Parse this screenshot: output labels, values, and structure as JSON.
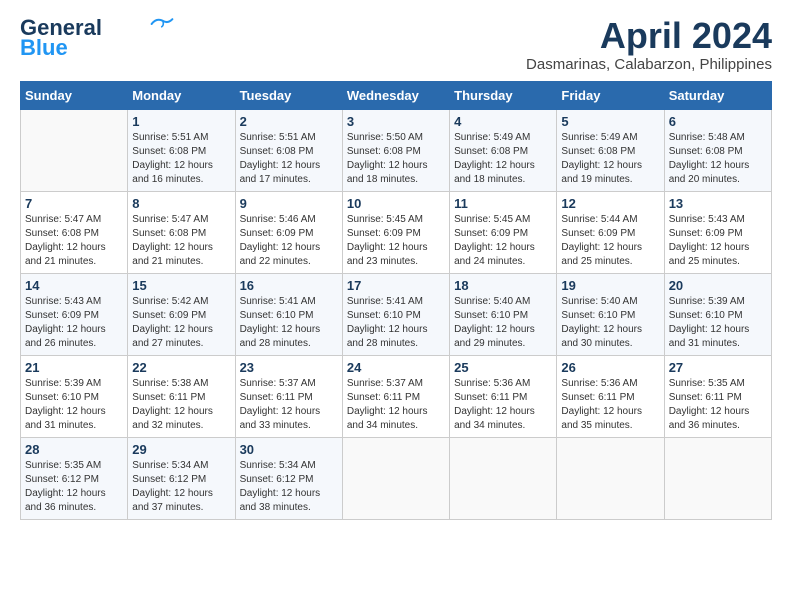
{
  "header": {
    "logo_line1": "General",
    "logo_line2": "Blue",
    "month_title": "April 2024",
    "location": "Dasmarinas, Calabarzon, Philippines"
  },
  "weekdays": [
    "Sunday",
    "Monday",
    "Tuesday",
    "Wednesday",
    "Thursday",
    "Friday",
    "Saturday"
  ],
  "weeks": [
    [
      {
        "day": "",
        "info": ""
      },
      {
        "day": "1",
        "info": "Sunrise: 5:51 AM\nSunset: 6:08 PM\nDaylight: 12 hours\nand 16 minutes."
      },
      {
        "day": "2",
        "info": "Sunrise: 5:51 AM\nSunset: 6:08 PM\nDaylight: 12 hours\nand 17 minutes."
      },
      {
        "day": "3",
        "info": "Sunrise: 5:50 AM\nSunset: 6:08 PM\nDaylight: 12 hours\nand 18 minutes."
      },
      {
        "day": "4",
        "info": "Sunrise: 5:49 AM\nSunset: 6:08 PM\nDaylight: 12 hours\nand 18 minutes."
      },
      {
        "day": "5",
        "info": "Sunrise: 5:49 AM\nSunset: 6:08 PM\nDaylight: 12 hours\nand 19 minutes."
      },
      {
        "day": "6",
        "info": "Sunrise: 5:48 AM\nSunset: 6:08 PM\nDaylight: 12 hours\nand 20 minutes."
      }
    ],
    [
      {
        "day": "7",
        "info": "Sunrise: 5:47 AM\nSunset: 6:08 PM\nDaylight: 12 hours\nand 21 minutes."
      },
      {
        "day": "8",
        "info": "Sunrise: 5:47 AM\nSunset: 6:08 PM\nDaylight: 12 hours\nand 21 minutes."
      },
      {
        "day": "9",
        "info": "Sunrise: 5:46 AM\nSunset: 6:09 PM\nDaylight: 12 hours\nand 22 minutes."
      },
      {
        "day": "10",
        "info": "Sunrise: 5:45 AM\nSunset: 6:09 PM\nDaylight: 12 hours\nand 23 minutes."
      },
      {
        "day": "11",
        "info": "Sunrise: 5:45 AM\nSunset: 6:09 PM\nDaylight: 12 hours\nand 24 minutes."
      },
      {
        "day": "12",
        "info": "Sunrise: 5:44 AM\nSunset: 6:09 PM\nDaylight: 12 hours\nand 25 minutes."
      },
      {
        "day": "13",
        "info": "Sunrise: 5:43 AM\nSunset: 6:09 PM\nDaylight: 12 hours\nand 25 minutes."
      }
    ],
    [
      {
        "day": "14",
        "info": "Sunrise: 5:43 AM\nSunset: 6:09 PM\nDaylight: 12 hours\nand 26 minutes."
      },
      {
        "day": "15",
        "info": "Sunrise: 5:42 AM\nSunset: 6:09 PM\nDaylight: 12 hours\nand 27 minutes."
      },
      {
        "day": "16",
        "info": "Sunrise: 5:41 AM\nSunset: 6:10 PM\nDaylight: 12 hours\nand 28 minutes."
      },
      {
        "day": "17",
        "info": "Sunrise: 5:41 AM\nSunset: 6:10 PM\nDaylight: 12 hours\nand 28 minutes."
      },
      {
        "day": "18",
        "info": "Sunrise: 5:40 AM\nSunset: 6:10 PM\nDaylight: 12 hours\nand 29 minutes."
      },
      {
        "day": "19",
        "info": "Sunrise: 5:40 AM\nSunset: 6:10 PM\nDaylight: 12 hours\nand 30 minutes."
      },
      {
        "day": "20",
        "info": "Sunrise: 5:39 AM\nSunset: 6:10 PM\nDaylight: 12 hours\nand 31 minutes."
      }
    ],
    [
      {
        "day": "21",
        "info": "Sunrise: 5:39 AM\nSunset: 6:10 PM\nDaylight: 12 hours\nand 31 minutes."
      },
      {
        "day": "22",
        "info": "Sunrise: 5:38 AM\nSunset: 6:11 PM\nDaylight: 12 hours\nand 32 minutes."
      },
      {
        "day": "23",
        "info": "Sunrise: 5:37 AM\nSunset: 6:11 PM\nDaylight: 12 hours\nand 33 minutes."
      },
      {
        "day": "24",
        "info": "Sunrise: 5:37 AM\nSunset: 6:11 PM\nDaylight: 12 hours\nand 34 minutes."
      },
      {
        "day": "25",
        "info": "Sunrise: 5:36 AM\nSunset: 6:11 PM\nDaylight: 12 hours\nand 34 minutes."
      },
      {
        "day": "26",
        "info": "Sunrise: 5:36 AM\nSunset: 6:11 PM\nDaylight: 12 hours\nand 35 minutes."
      },
      {
        "day": "27",
        "info": "Sunrise: 5:35 AM\nSunset: 6:11 PM\nDaylight: 12 hours\nand 36 minutes."
      }
    ],
    [
      {
        "day": "28",
        "info": "Sunrise: 5:35 AM\nSunset: 6:12 PM\nDaylight: 12 hours\nand 36 minutes."
      },
      {
        "day": "29",
        "info": "Sunrise: 5:34 AM\nSunset: 6:12 PM\nDaylight: 12 hours\nand 37 minutes."
      },
      {
        "day": "30",
        "info": "Sunrise: 5:34 AM\nSunset: 6:12 PM\nDaylight: 12 hours\nand 38 minutes."
      },
      {
        "day": "",
        "info": ""
      },
      {
        "day": "",
        "info": ""
      },
      {
        "day": "",
        "info": ""
      },
      {
        "day": "",
        "info": ""
      }
    ]
  ]
}
